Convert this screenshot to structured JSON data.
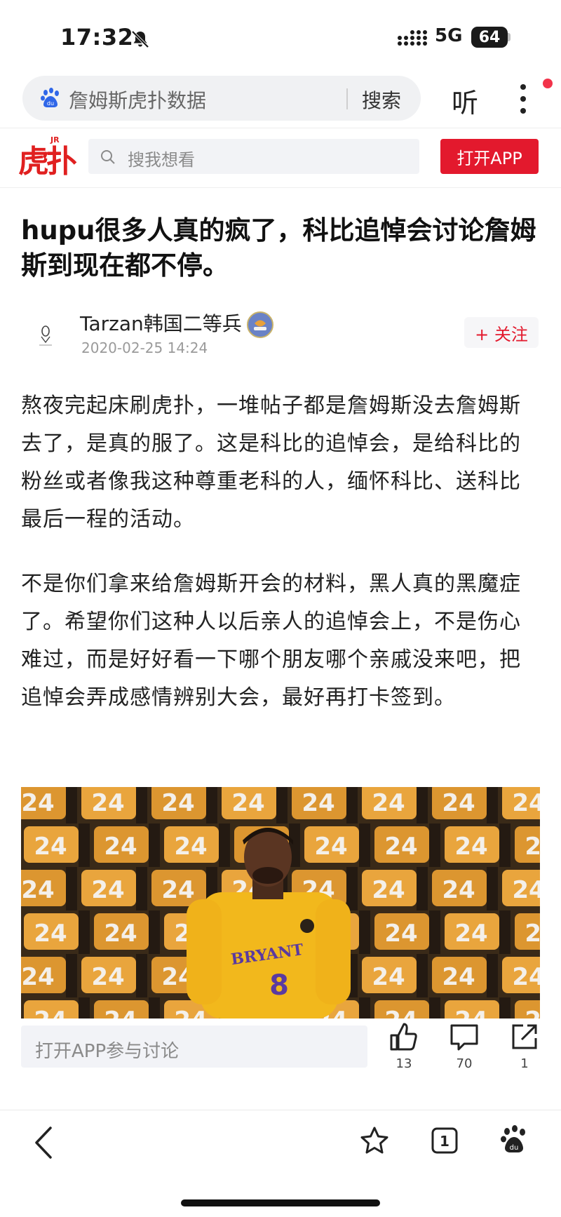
{
  "status_bar": {
    "time": "17:32",
    "network": "5G",
    "battery": "64"
  },
  "baidu": {
    "query": "詹姆斯虎扑数据",
    "search_label": "搜索",
    "listen_label": "听"
  },
  "site_header": {
    "logo_text": "虎扑",
    "logo_tag": "JR",
    "search_placeholder": "搜我想看",
    "open_app_label": "打开APP"
  },
  "article": {
    "title": "hupu很多人真的疯了，科比追悼会讨论詹姆斯到现在都不停。",
    "author": "Tarzan韩国二等兵",
    "date": "2020-02-25 14:24",
    "follow_label": "+ 关注",
    "paragraphs": [
      "熬夜完起床刷虎扑，一堆帖子都是詹姆斯没去詹姆斯去了，是真的服了。这是科比的追悼会，是给科比的粉丝或者像我这种尊重老科的人，缅怀科比、送科比最后一程的活动。",
      "不是你们拿来给詹姆斯开会的材料，黑人真的黑魔症了。希望你们这种人以后亲人的追悼会上，不是伤心难过，而是好好看一下哪个朋友哪个亲戚没来吧，把追悼会弄成感情辨别大会，最好再打卡签到。"
    ],
    "photo": {
      "seat_number": "24",
      "jersey_name": "BRYANT",
      "jersey_number": "8"
    }
  },
  "comment_bar": {
    "placeholder": "打开APP参与讨论",
    "likes": "13",
    "comments": "70",
    "shares": "1"
  },
  "bottom_nav": {
    "tab_count": "1"
  },
  "colors": {
    "brand_red": "#e3192d",
    "baidu_blue": "#2f66e8"
  },
  "icons": [
    "bell-off-icon",
    "signal-icon",
    "baidu-paw-icon",
    "more-icon",
    "search-icon",
    "thumbs-up-icon",
    "comment-icon",
    "share-icon",
    "back-icon",
    "star-icon",
    "tabs-icon",
    "baidu-paw-icon"
  ]
}
